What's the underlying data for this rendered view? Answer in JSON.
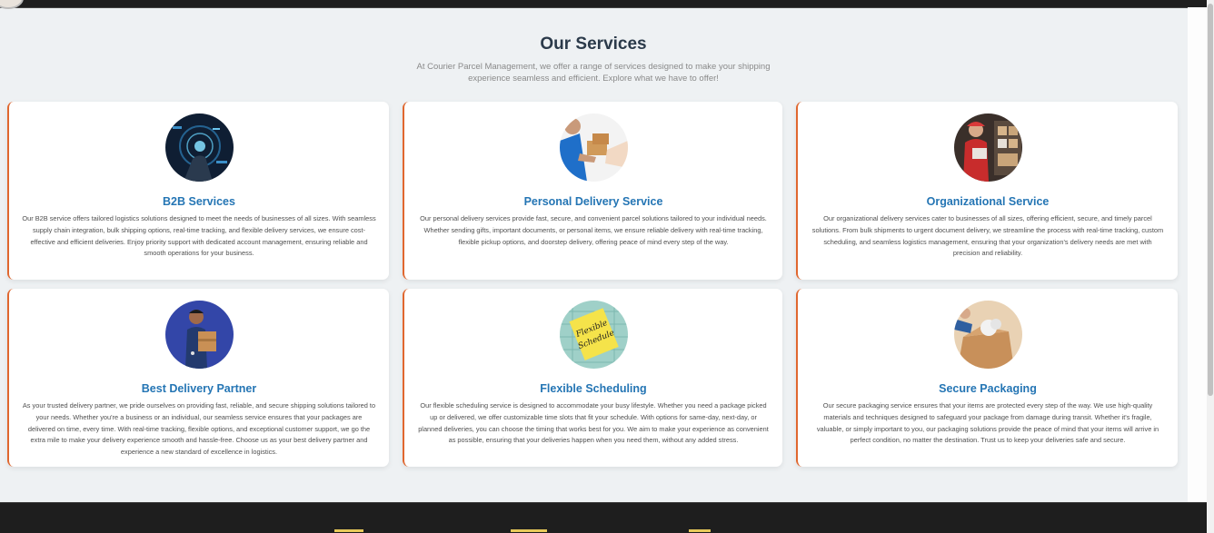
{
  "page": {
    "title": "Our Services",
    "subtitle": "At Courier Parcel Management, we offer a range of services designed to make your shipping experience seamless and efficient. Explore what we have to offer!"
  },
  "colors": {
    "accent": "#e0672f",
    "card_title": "#2475b4",
    "heading": "#2b3a4a",
    "footer": "#1e1e1e",
    "footer_accent": "#e7c95a"
  },
  "services": [
    {
      "title": "B2B Services",
      "image": "b2b-tech-image",
      "description": "Our B2B service offers tailored logistics solutions designed to meet the needs of businesses of all sizes. With seamless supply chain integration, bulk shipping options, real-time tracking, and flexible delivery services, we ensure cost-effective and efficient deliveries. Enjoy priority support with dedicated account management, ensuring reliable and smooth operations for your business."
    },
    {
      "title": "Personal Delivery Service",
      "image": "package-handover-image",
      "description": "Our personal delivery services provide fast, secure, and convenient parcel solutions tailored to your individual needs. Whether sending gifts, important documents, or personal items, we ensure reliable delivery with real-time tracking, flexible pickup options, and doorstep delivery, offering peace of mind every step of the way."
    },
    {
      "title": "Organizational Service",
      "image": "warehouse-worker-image",
      "description": "Our organizational delivery services cater to businesses of all sizes, offering efficient, secure, and timely parcel solutions. From bulk shipments to urgent document delivery, we streamline the process with real-time tracking, custom scheduling, and seamless logistics management, ensuring that your organization's delivery needs are met with precision and reliability."
    },
    {
      "title": "Best Delivery Partner",
      "image": "delivery-man-image",
      "description": "As your trusted delivery partner, we pride ourselves on providing fast, reliable, and secure shipping solutions tailored to your needs. Whether you're a business or an individual, our seamless service ensures that your packages are delivered on time, every time. With real-time tracking, flexible options, and exceptional customer support, we go the extra mile to make your delivery experience smooth and hassle-free. Choose us as your best delivery partner and experience a new standard of excellence in logistics."
    },
    {
      "title": "Flexible Scheduling",
      "image": "flexible-schedule-note-image",
      "image_text": "Flexible Schedule",
      "description": "Our flexible scheduling service is designed to accommodate your busy lifestyle. Whether you need a package picked up or delivered, we offer customizable time slots that fit your schedule. With options for same-day, next-day, or planned deliveries, you can choose the timing that works best for you. We aim to make your experience as convenient as possible, ensuring that your deliveries happen when you need them, without any added stress."
    },
    {
      "title": "Secure Packaging",
      "image": "packing-box-image",
      "description": "Our secure packaging service ensures that your items are protected every step of the way. We use high-quality materials and techniques designed to safeguard your package from damage during transit. Whether it's fragile, valuable, or simply important to you, our packaging solutions provide the peace of mind that your items will arrive in perfect condition, no matter the destination. Trust us to keep your deliveries safe and secure."
    }
  ]
}
